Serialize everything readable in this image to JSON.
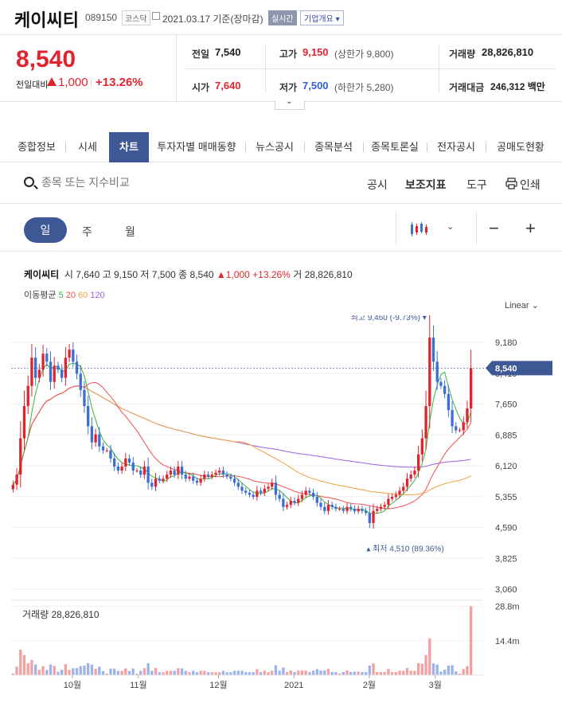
{
  "header": {
    "stock_name": "케이씨티",
    "stock_code": "089150",
    "market": "코스닥",
    "date_text": "2021.03.17  기준(장마감)",
    "realtime_badge": "실시간",
    "company_button": "기업개요 ▾"
  },
  "price": {
    "current": "8,540",
    "prev_label": "전일대비",
    "change": "1,000",
    "change_pct": "+13.26%",
    "direction": "up"
  },
  "summary": {
    "prev_close_label": "전일",
    "prev_close": "7,540",
    "open_label": "시가",
    "open": "7,640",
    "high_label": "고가",
    "high": "9,150",
    "high_limit": "(상한가 9,800)",
    "low_label": "저가",
    "low": "7,500",
    "low_limit": "(하한가 5,280)",
    "volume_label": "거래량",
    "volume": "28,826,810",
    "value_label": "거래대금",
    "value": "246,312 백만"
  },
  "tabs": [
    {
      "label": "종합정보",
      "active": false
    },
    {
      "label": "시세",
      "active": false
    },
    {
      "label": "차트",
      "active": true
    },
    {
      "label": "투자자별 매매동향",
      "active": false
    },
    {
      "label": "뉴스공시",
      "active": false
    },
    {
      "label": "종목분석",
      "active": false
    },
    {
      "label": "종목토론실",
      "active": false
    },
    {
      "label": "전자공시",
      "active": false
    },
    {
      "label": "공매도현황",
      "active": false
    }
  ],
  "search": {
    "placeholder": "종목 또는 지수비교"
  },
  "tools": {
    "notice": "공시",
    "indicator": "보조지표",
    "tool": "도구",
    "print": "인쇄"
  },
  "periods": {
    "day": "일",
    "week": "주",
    "month": "월"
  },
  "legend": {
    "name": "케이씨티",
    "open_lbl": "시",
    "open": "7,640",
    "high_lbl": "고",
    "high": "9,150",
    "low_lbl": "저",
    "low": "7,500",
    "close_lbl": "종",
    "close": "8,540",
    "change": "▲1,000 +13.26%",
    "vol_lbl": "거",
    "vol": "28,826,810"
  },
  "ma_legend": {
    "label": "이동평균",
    "items": [
      {
        "name": "5",
        "color": "#3bb33b"
      },
      {
        "name": "20",
        "color": "#f05050"
      },
      {
        "name": "60",
        "color": "#f0a040"
      },
      {
        "name": "120",
        "color": "#a060e0"
      }
    ]
  },
  "scale_mode": "Linear",
  "colors": {
    "up": "#e0242e",
    "down": "#3c6fd6",
    "accent": "#3e5896"
  },
  "chart_data": {
    "type": "candlestick",
    "y_ticks": [
      "9,180",
      "8,415",
      "7,650",
      "6,885",
      "6,120",
      "5,355",
      "4,590",
      "3,825",
      "3,060"
    ],
    "y_tick_values": [
      9180,
      8415,
      7650,
      6885,
      6120,
      5355,
      4590,
      3825,
      3060
    ],
    "ylim": [
      3060,
      9180
    ],
    "x_labels": [
      "10월",
      "11월",
      "12월",
      "2021",
      "2월",
      "3월"
    ],
    "x_label_positions_fraction": [
      0.13,
      0.27,
      0.44,
      0.6,
      0.76,
      0.9
    ],
    "current_price_tag": "8,540",
    "current_price_value": 8540,
    "max_annotation": "최고 9,460 (-9.73%)",
    "max_value": 9460,
    "min_annotation": "최저 4,510 (89.36%)",
    "min_value": 4510,
    "close_series": [
      5650,
      5900,
      6800,
      7600,
      8100,
      8800,
      8300,
      8500,
      8900,
      8700,
      8200,
      8600,
      8500,
      8300,
      8800,
      9000,
      8700,
      8400,
      8000,
      7600,
      7100,
      6700,
      6900,
      6600,
      6500,
      6500,
      6300,
      6100,
      6000,
      6100,
      6300,
      6200,
      6000,
      6000,
      5900,
      6100,
      5700,
      5600,
      5800,
      5750,
      5800,
      5900,
      6000,
      5900,
      6100,
      5900,
      5800,
      5850,
      5750,
      5700,
      5800,
      5900,
      5850,
      5900,
      5950,
      6000,
      5900,
      5850,
      5800,
      5700,
      5600,
      5500,
      5450,
      5400,
      5350,
      5500,
      5450,
      5550,
      5600,
      5700,
      5400,
      5300,
      5100,
      5150,
      5250,
      5200,
      5300,
      5400,
      5500,
      5450,
      5350,
      5200,
      5100,
      5000,
      5150,
      5100,
      5050,
      5050,
      5000,
      5100,
      5050,
      4990,
      5050,
      5000,
      4950,
      4700,
      5000,
      5050,
      5100,
      5150,
      5300,
      5350,
      5400,
      5500,
      5600,
      5800,
      5900,
      6000,
      6400,
      6800,
      7600,
      9300,
      8700,
      8200,
      8100,
      7900,
      7500,
      7100,
      7000,
      7000,
      7200,
      7540,
      8540
    ],
    "volume_label": "거래량",
    "volume_value": "28,826,810",
    "volume_ticks": [
      "28.8m",
      "14.4m"
    ],
    "volume_tick_values": [
      28800000,
      14400000
    ]
  }
}
